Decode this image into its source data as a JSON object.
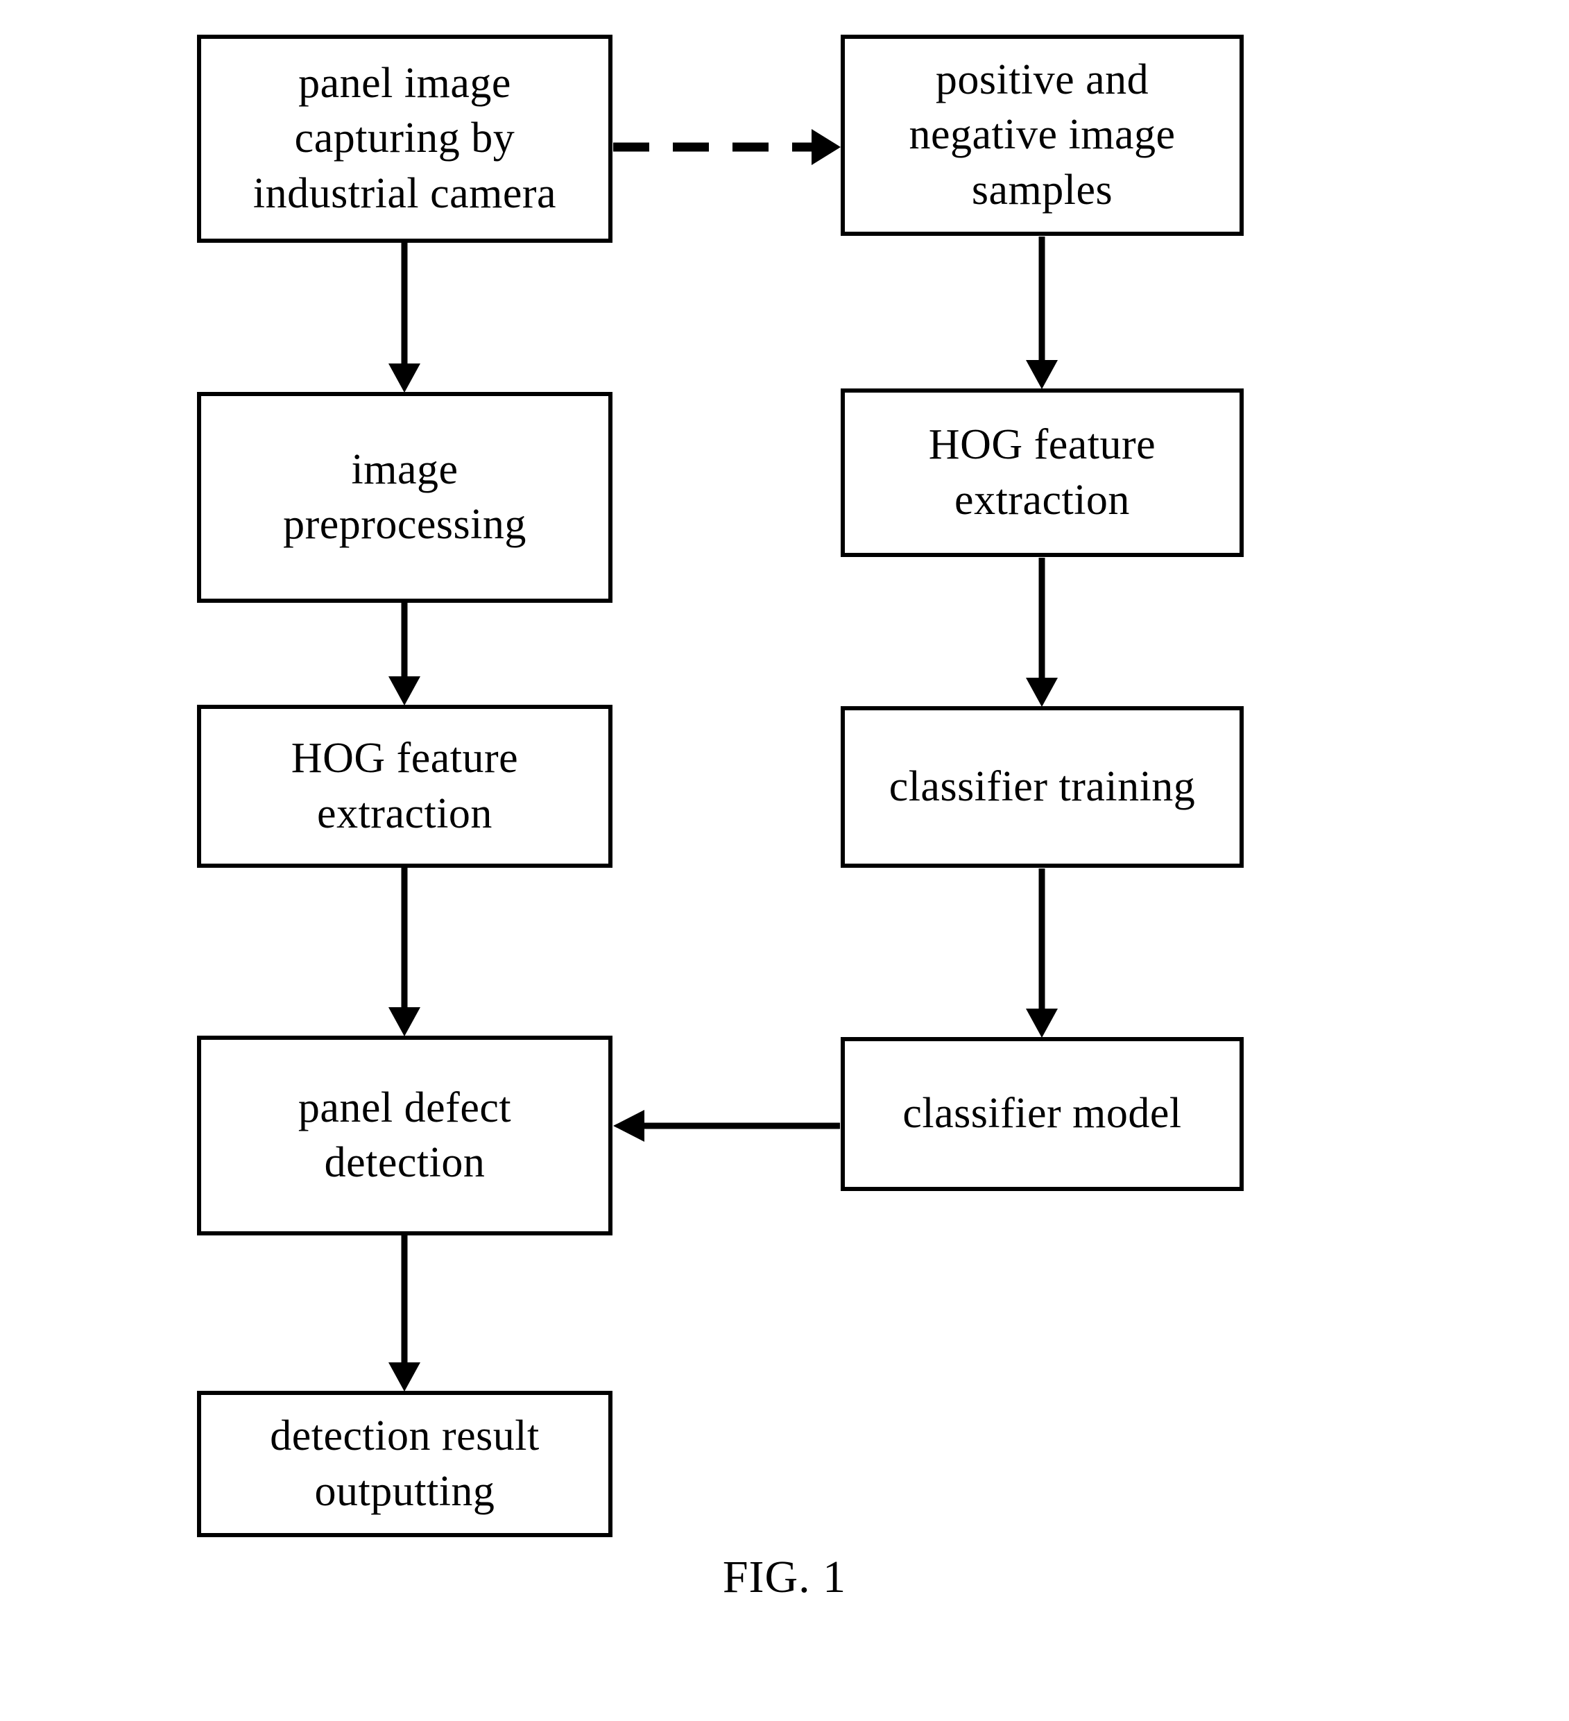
{
  "figure": {
    "caption": "FIG. 1",
    "background_color": "#ffffff",
    "line_color": "#000000"
  },
  "nodes": [
    {
      "id": "capture",
      "label": "panel image\ncapturing  by\nindustrial camera"
    },
    {
      "id": "samples",
      "label": "positive and\nnegative image\nsamples"
    },
    {
      "id": "preprocess",
      "label": "image\npreprocessing"
    },
    {
      "id": "hog_train",
      "label": "HOG feature\nextraction"
    },
    {
      "id": "hog_detect",
      "label": "HOG feature\nextraction"
    },
    {
      "id": "classifier_training",
      "label": "classifier training"
    },
    {
      "id": "defect",
      "label": "panel defect\ndetection"
    },
    {
      "id": "classifier_model",
      "label": "classifier model"
    },
    {
      "id": "output",
      "label": "detection result\noutputting"
    }
  ],
  "edges": [
    {
      "from": "capture",
      "to": "samples",
      "style": "dashed",
      "direction": "right"
    },
    {
      "from": "capture",
      "to": "preprocess",
      "style": "solid",
      "direction": "down"
    },
    {
      "from": "preprocess",
      "to": "hog_detect",
      "style": "solid",
      "direction": "down"
    },
    {
      "from": "hog_detect",
      "to": "defect",
      "style": "solid",
      "direction": "down"
    },
    {
      "from": "defect",
      "to": "output",
      "style": "solid",
      "direction": "down"
    },
    {
      "from": "samples",
      "to": "hog_train",
      "style": "solid",
      "direction": "down"
    },
    {
      "from": "hog_train",
      "to": "classifier_training",
      "style": "solid",
      "direction": "down"
    },
    {
      "from": "classifier_training",
      "to": "classifier_model",
      "style": "solid",
      "direction": "down"
    },
    {
      "from": "classifier_model",
      "to": "defect",
      "style": "solid",
      "direction": "left"
    }
  ]
}
